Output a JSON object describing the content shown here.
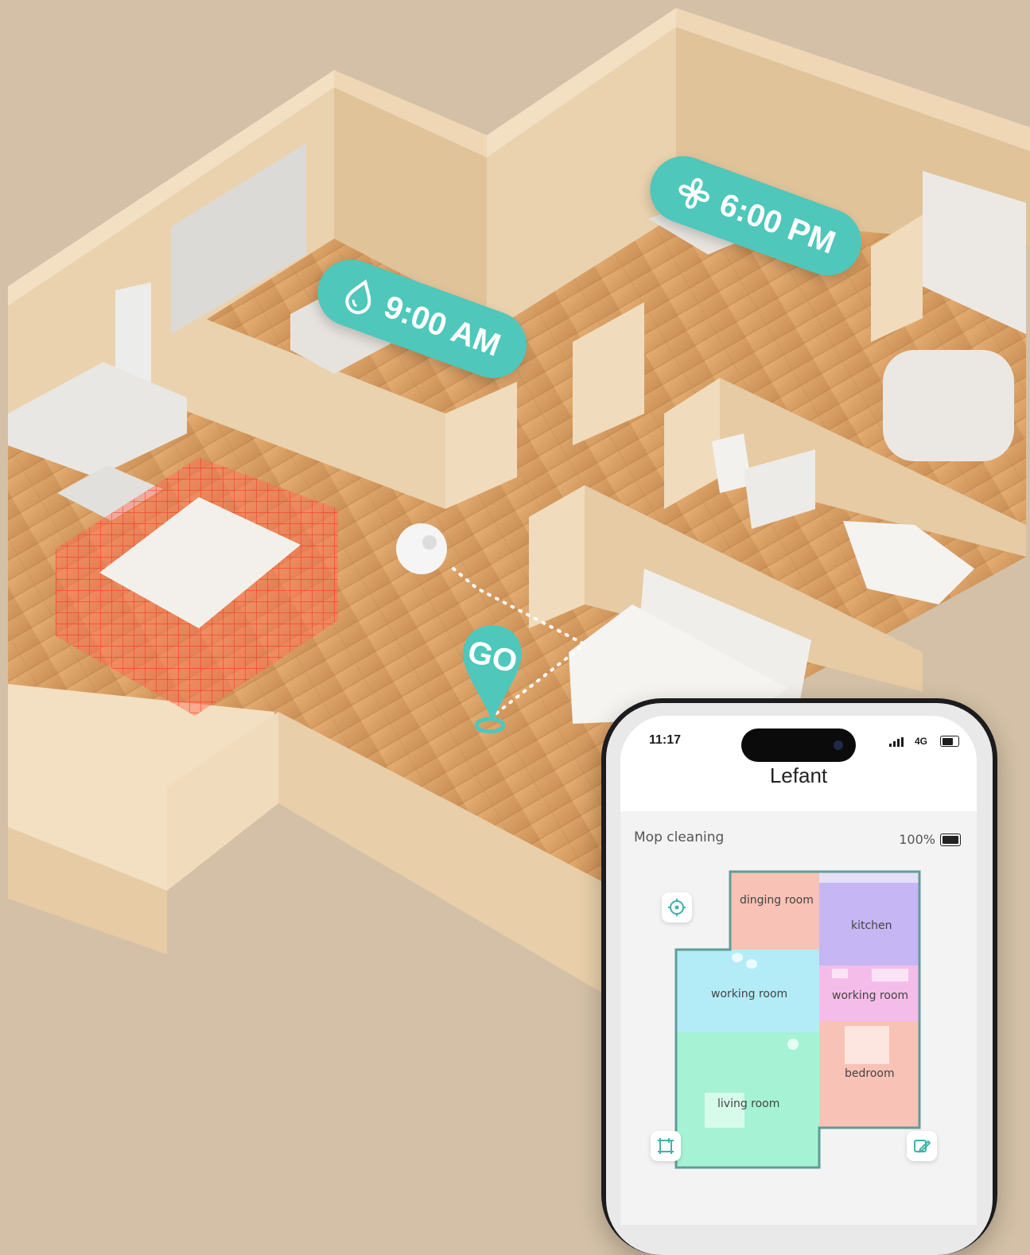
{
  "scene": {
    "tags": [
      {
        "id": "am",
        "time": "9:00 AM",
        "icon": "water-drop-icon"
      },
      {
        "id": "pm",
        "time": "6:00 PM",
        "icon": "fan-icon"
      }
    ],
    "go_label": "GO",
    "accent": "#4fc7bb",
    "no_go_zone_color": "#ff4b3a"
  },
  "phone": {
    "status": {
      "time": "11:17",
      "network": "4G"
    },
    "app_title": "Lefant",
    "mode": "Mop cleaning",
    "battery": "100%",
    "map": {
      "rooms": [
        {
          "label": "dinging room",
          "color": "#f8c2b6"
        },
        {
          "label": "kitchen",
          "color": "#c6b6f4"
        },
        {
          "label": "working room",
          "color": "#b3ecf6"
        },
        {
          "label": "working room",
          "color": "#f4bde9"
        },
        {
          "label": "bedroom",
          "color": "#f8c2b6"
        },
        {
          "label": "living room",
          "color": "#a6f2d4"
        }
      ],
      "outline_color": "#5d9e97"
    }
  }
}
